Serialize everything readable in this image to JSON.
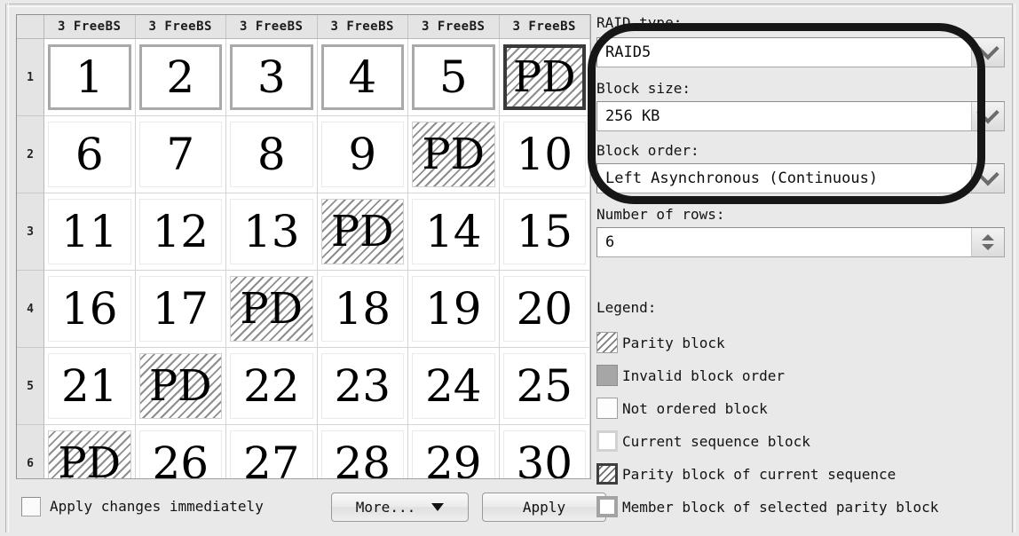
{
  "grid": {
    "column_headers": [
      "3 FreeBS",
      "3 FreeBS",
      "3 FreeBS",
      "3 FreeBS",
      "3 FreeBS",
      "3 FreeBS"
    ],
    "row_headers": [
      "1",
      "2",
      "3",
      "4",
      "5",
      "6"
    ],
    "cells": [
      [
        {
          "label": "1",
          "type": "member"
        },
        {
          "label": "2",
          "type": "member"
        },
        {
          "label": "3",
          "type": "member"
        },
        {
          "label": "4",
          "type": "member"
        },
        {
          "label": "5",
          "type": "member"
        },
        {
          "label": "PD",
          "type": "parity-current"
        }
      ],
      [
        {
          "label": "6",
          "type": "data"
        },
        {
          "label": "7",
          "type": "data"
        },
        {
          "label": "8",
          "type": "data"
        },
        {
          "label": "9",
          "type": "data"
        },
        {
          "label": "PD",
          "type": "parity"
        },
        {
          "label": "10",
          "type": "data"
        }
      ],
      [
        {
          "label": "11",
          "type": "data"
        },
        {
          "label": "12",
          "type": "data"
        },
        {
          "label": "13",
          "type": "data"
        },
        {
          "label": "PD",
          "type": "parity"
        },
        {
          "label": "14",
          "type": "data"
        },
        {
          "label": "15",
          "type": "data"
        }
      ],
      [
        {
          "label": "16",
          "type": "data"
        },
        {
          "label": "17",
          "type": "data"
        },
        {
          "label": "PD",
          "type": "parity"
        },
        {
          "label": "18",
          "type": "data"
        },
        {
          "label": "19",
          "type": "data"
        },
        {
          "label": "20",
          "type": "data"
        }
      ],
      [
        {
          "label": "21",
          "type": "data"
        },
        {
          "label": "PD",
          "type": "parity"
        },
        {
          "label": "22",
          "type": "data"
        },
        {
          "label": "23",
          "type": "data"
        },
        {
          "label": "24",
          "type": "data"
        },
        {
          "label": "25",
          "type": "data"
        }
      ],
      [
        {
          "label": "PD",
          "type": "parity"
        },
        {
          "label": "26",
          "type": "data"
        },
        {
          "label": "27",
          "type": "data"
        },
        {
          "label": "28",
          "type": "data"
        },
        {
          "label": "29",
          "type": "data"
        },
        {
          "label": "30",
          "type": "data"
        }
      ]
    ]
  },
  "bottom_bar": {
    "apply_immediately_label": "Apply changes immediately",
    "apply_immediately_checked": false,
    "more_label": "More...",
    "apply_label": "Apply"
  },
  "settings": {
    "raid_type": {
      "label": "RAID type:",
      "value": "RAID5"
    },
    "block_size": {
      "label": "Block size:",
      "value": "256 KB"
    },
    "block_order": {
      "label": "Block order:",
      "value": "Left Asynchronous (Continuous)"
    },
    "number_of_rows": {
      "label": "Number of rows:",
      "value": "6"
    }
  },
  "legend": {
    "title": "Legend:",
    "items": [
      {
        "label": "Parity block",
        "swatch": "parity-hatch-swatch"
      },
      {
        "label": "Invalid block order",
        "swatch": "solid-gray-swatch"
      },
      {
        "label": "Not ordered block",
        "swatch": "white-swatch"
      },
      {
        "label": "Current sequence block",
        "swatch": "light-border-swatch"
      },
      {
        "label": "Parity block of current sequence",
        "swatch": "dark-border-hatch-swatch"
      },
      {
        "label": "Member block of selected parity block",
        "swatch": "gray-border-swatch"
      }
    ]
  },
  "annotation": {
    "shape": "rounded-rectangle-highlight",
    "color": "#161616"
  },
  "colors": {
    "panel_background": "#e9e9e9",
    "grid_background": "#ffffff",
    "header_background": "#e4e4e4",
    "hatch_line": "#8d8d8d",
    "selected_border": "#3a3a3a",
    "member_border": "#a9a9a9",
    "invalid_fill": "#a6a6a6"
  }
}
